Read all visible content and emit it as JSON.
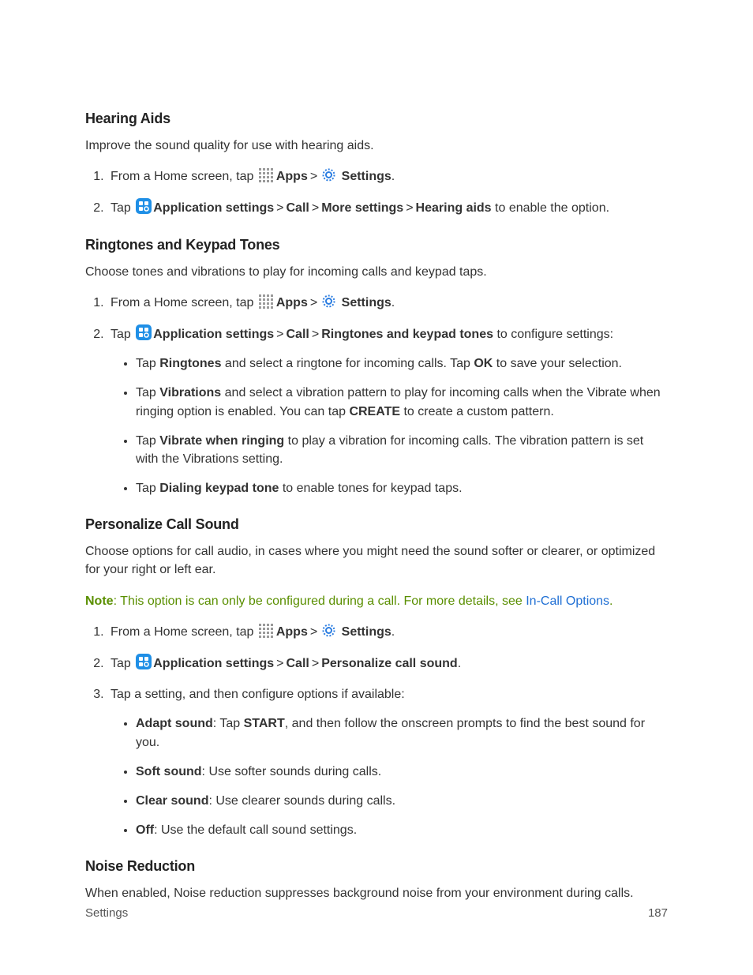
{
  "sections": {
    "hearing_aids": {
      "heading": "Hearing Aids",
      "intro": "Improve the sound quality for use with hearing aids.",
      "step1_a": "From a Home screen, tap ",
      "step1_apps": "Apps",
      "step1_settings": "Settings",
      "step1_dot": ".",
      "step2_a": "Tap ",
      "step2_appset": "Application settings",
      "step2_call": "Call",
      "step2_more": "More settings",
      "step2_ha": "Hearing aids",
      "step2_tail": " to enable the option."
    },
    "ringtones": {
      "heading": "Ringtones and Keypad Tones",
      "intro": "Choose tones and vibrations to play for incoming calls and keypad taps.",
      "step1_a": "From a Home screen, tap ",
      "step1_apps": "Apps",
      "step1_settings": "Settings",
      "step1_dot": ".",
      "step2_a": "Tap ",
      "step2_appset": "Application settings",
      "step2_call": "Call",
      "step2_rkt": "Ringtones and keypad tones",
      "step2_tail": " to configure settings:",
      "b1_a": "Tap ",
      "b1_ring": "Ringtones",
      "b1_mid": " and select a ringtone for incoming calls. Tap ",
      "b1_ok": "OK",
      "b1_tail": " to save your selection.",
      "b2_a": "Tap ",
      "b2_vib": "Vibrations",
      "b2_mid": " and select a vibration pattern to play for incoming calls when the Vibrate when ringing option is enabled. You can tap ",
      "b2_create": "CREATE",
      "b2_tail": " to create a custom pattern.",
      "b3_a": "Tap ",
      "b3_vwr": "Vibrate when ringing",
      "b3_tail": " to play a vibration for incoming calls. The vibration pattern is set with the Vibrations setting.",
      "b4_a": "Tap ",
      "b4_dkt": "Dialing keypad tone",
      "b4_tail": " to enable tones for keypad taps."
    },
    "personalize": {
      "heading": "Personalize Call Sound",
      "intro": "Choose options for call audio, in cases where you might need the sound softer or clearer, or optimized for your right or left ear.",
      "note_bold": "Note",
      "note_text": ": This option is can only be configured during a call. For more details, see ",
      "note_link": "In-Call Options",
      "note_dot": ".",
      "step1_a": "From a Home screen, tap ",
      "step1_apps": "Apps",
      "step1_settings": "Settings",
      "step1_dot": ".",
      "step2_a": "Tap ",
      "step2_appset": "Application settings",
      "step2_call": "Call",
      "step2_pcs": "Personalize call sound",
      "step2_dot": ".",
      "step3": "Tap a setting, and then configure options if available:",
      "b1_k": "Adapt sound",
      "b1_mid": ": Tap ",
      "b1_start": "START",
      "b1_tail": ", and then follow the onscreen prompts to find the best sound for you.",
      "b2_k": "Soft sound",
      "b2_tail": ": Use softer sounds during calls.",
      "b3_k": "Clear sound",
      "b3_tail": ": Use clearer sounds during calls.",
      "b4_k": "Off",
      "b4_tail": ": Use the default call sound settings."
    },
    "noise": {
      "heading": "Noise Reduction",
      "intro": "When enabled, Noise reduction suppresses background noise from your environment during calls."
    }
  },
  "sep": ">",
  "footer": {
    "left": "Settings",
    "right": "187"
  }
}
